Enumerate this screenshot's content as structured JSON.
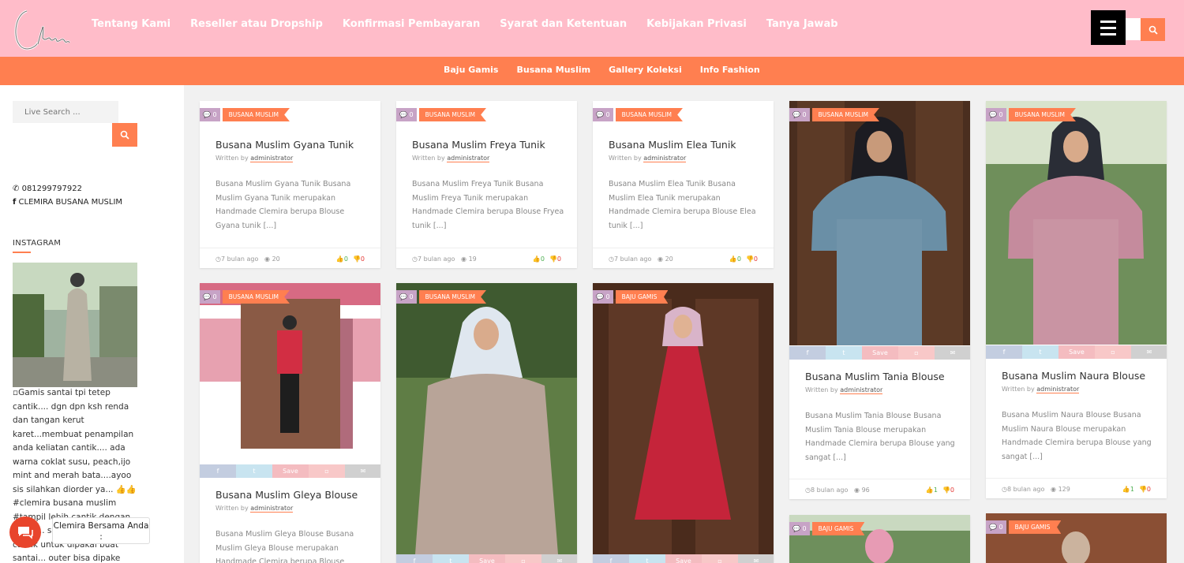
{
  "header": {
    "logo_text": "Clemira",
    "nav": [
      "Tentang Kami",
      "Reseller atau Dropship",
      "Konfirmasi Pembayaran",
      "Syarat dan Ketentuan",
      "Kebijakan Privasi",
      "Tanya Jawab"
    ]
  },
  "subnav": [
    "Baju Gamis",
    "Busana Muslim",
    "Gallery Koleksi",
    "Info Fashion"
  ],
  "sidebar": {
    "search_placeholder": "Live Search ...",
    "phone": "081299797922",
    "facebook": "CLEMIRA BUSANA MUSLIM",
    "widget_title": "INSTAGRAM",
    "ig_alt": "Gamis santai tpi tetep cantik.... dgn dpn ksh renda dan tangan kerut karet...membuat penampilan anda keliatan cantik.... ada warna coklat susu, peach,ijo mint and merah bata....ayoo sis silahkan diorder ya... 👍👍 #clemira busana muslim #tampil lebih cantik dengan ... sis ... santai ... sangat cantik untuk dipakai buat santai... outer bisa dipake"
  },
  "chat": {
    "label": "Clemira Bersama Anda :"
  },
  "posts": [
    {
      "comments": "0",
      "category": "BUSANA MUSLIM",
      "title": "Busana Muslim Gyana Tunik",
      "author_prefix": "Written by",
      "author": "administrator",
      "excerpt": "Busana Muslim Gyana Tunik Busana Muslim Gyana Tunik merupakan Handmade Clemira berupa Blouse Gyana tunik [...]",
      "time": "7 bulan ago",
      "views": "20",
      "likes": "0",
      "dislikes": "0"
    },
    {
      "comments": "0",
      "category": "BUSANA MUSLIM",
      "title": "Busana Muslim Freya Tunik",
      "author_prefix": "Written by",
      "author": "administrator",
      "excerpt": "Busana Muslim Freya Tunik Busana Muslim Freya Tunik merupakan Handmade Clemira berupa Blouse Fryea tunik [...]",
      "time": "7 bulan ago",
      "views": "19",
      "likes": "0",
      "dislikes": "0"
    },
    {
      "comments": "0",
      "category": "BUSANA MUSLIM",
      "title": "Busana Muslim Elea Tunik",
      "author_prefix": "Written by",
      "author": "administrator",
      "excerpt": "Busana Muslim Elea Tunik Busana Muslim Elea Tunik merupakan Handmade Clemira berupa Blouse Elea tunik [...]",
      "time": "7 bulan ago",
      "views": "20",
      "likes": "0",
      "dislikes": "0"
    },
    {
      "comments": "0",
      "category": "BUSANA MUSLIM",
      "title": "Busana Muslim Tania Blouse",
      "author_prefix": "Written by",
      "author": "administrator",
      "excerpt": "Busana Muslim Tania Blouse Busana Muslim Tania Blouse merupakan Handmade Clemira berupa Blouse yang sangat [...]",
      "time": "8 bulan ago",
      "views": "96",
      "likes": "1",
      "dislikes": "0",
      "save": "Save"
    },
    {
      "comments": "0",
      "category": "BUSANA MUSLIM",
      "title": "Busana Muslim Naura Blouse",
      "author_prefix": "Written by",
      "author": "administrator",
      "excerpt": "Busana Muslim Naura Blouse Busana Muslim Naura Blouse merupakan Handmade Clemira berupa Blouse yang sangat [...]",
      "time": "8 bulan ago",
      "views": "129",
      "likes": "1",
      "dislikes": "0",
      "save": "Save"
    },
    {
      "comments": "0",
      "category": "BUSANA MUSLIM",
      "title": "Busana Muslim Gleya Blouse",
      "author_prefix": "Written by",
      "author": "administrator",
      "excerpt": "Busana Muslim Gleya Blouse Busana Muslim Gleya Blouse merupakan Handmade Clemira berupa Blouse",
      "save": "Save"
    },
    {
      "comments": "0",
      "category": "BUSANA MUSLIM",
      "save": "Save"
    },
    {
      "comments": "0",
      "category": "BAJU GAMIS",
      "save": "Save"
    },
    {
      "comments": "0",
      "category": "BAJU GAMIS"
    },
    {
      "comments": "0",
      "category": "BAJU GAMIS"
    }
  ]
}
